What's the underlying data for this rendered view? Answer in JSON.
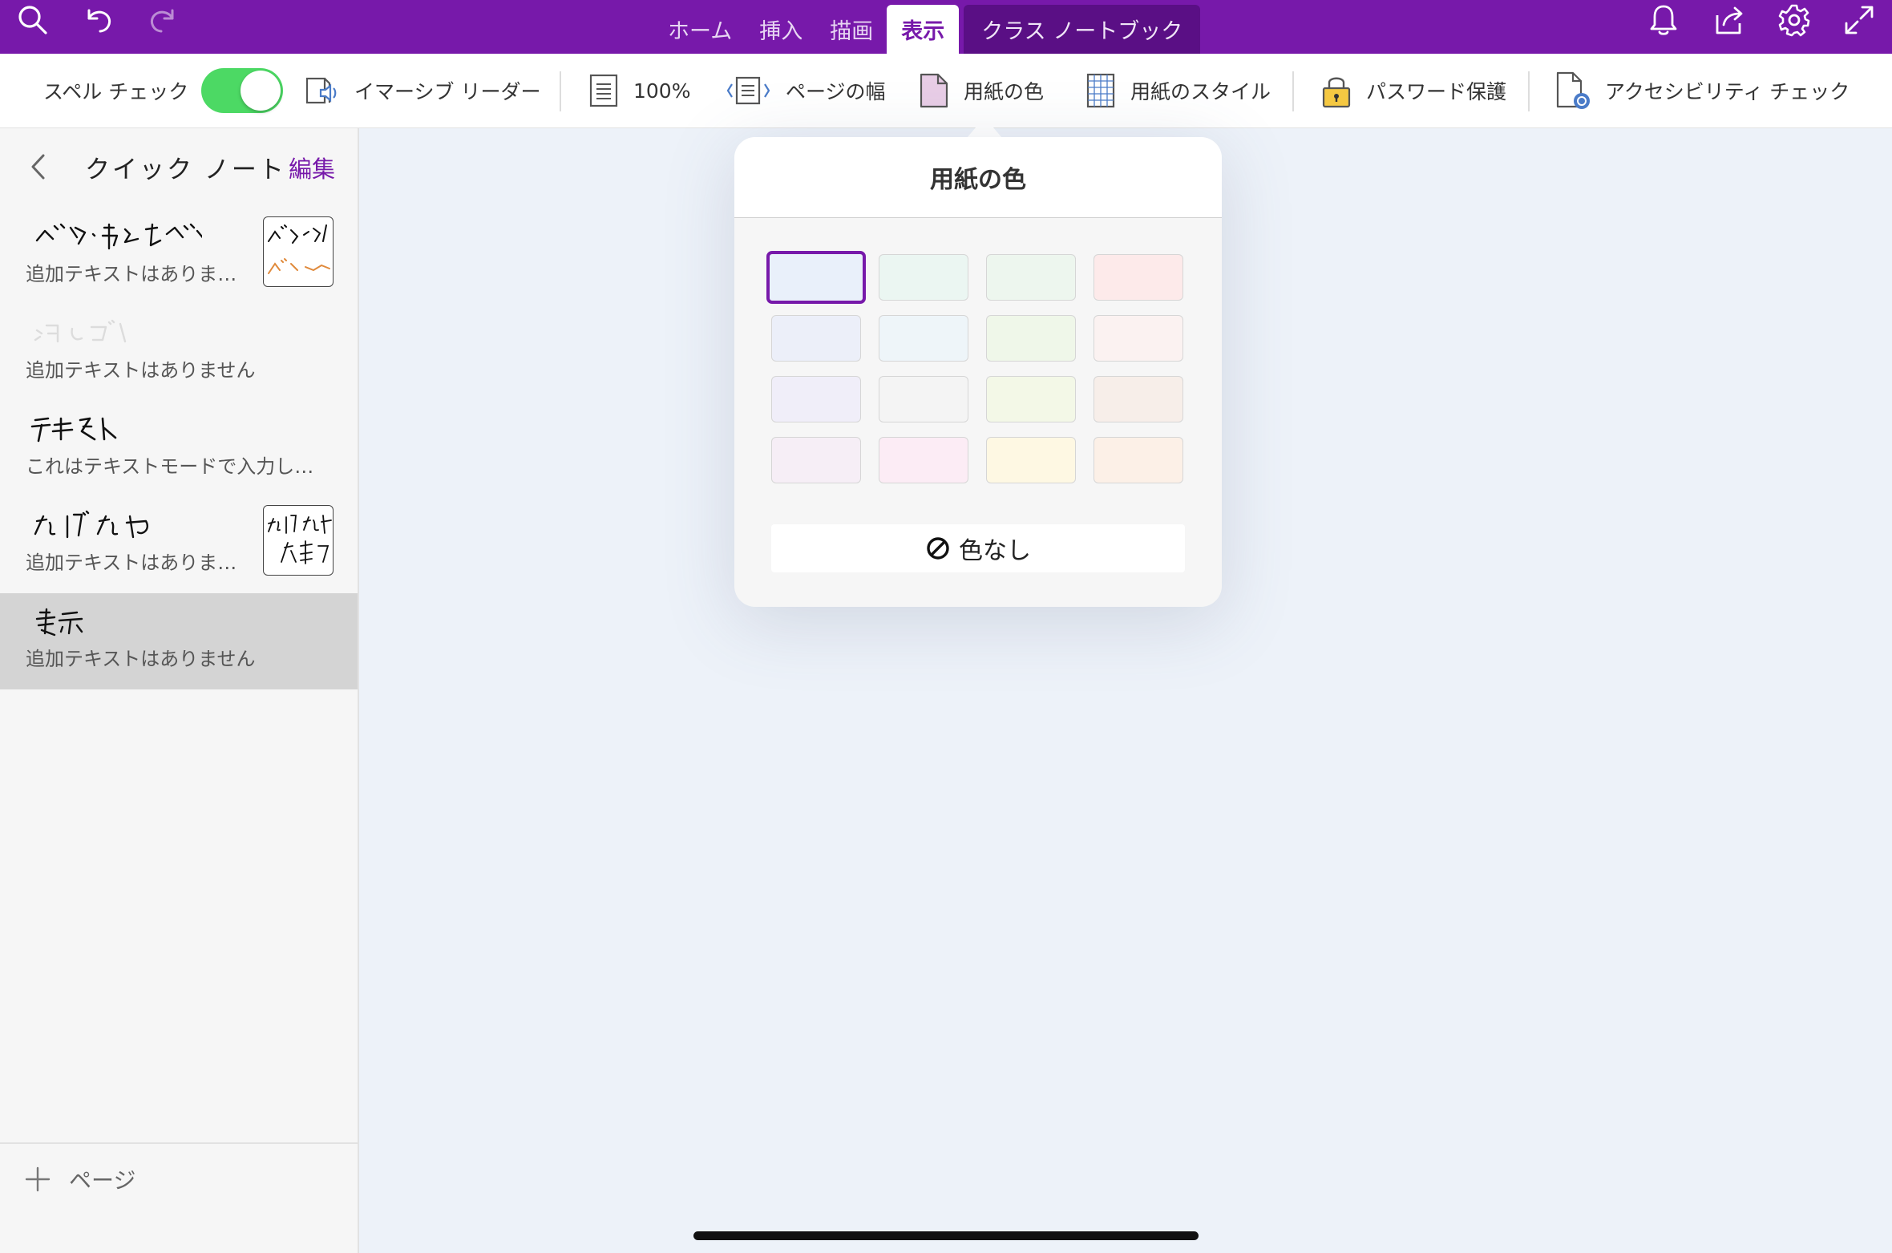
{
  "top_bar": {
    "tabs": [
      {
        "label": "ホーム"
      },
      {
        "label": "挿入"
      },
      {
        "label": "描画"
      },
      {
        "label": "表示"
      },
      {
        "label": "クラス ノートブック"
      }
    ],
    "active_tab": "表示",
    "accent_color": "#7719aa"
  },
  "ribbon": {
    "spell_check_label": "スペル チェック",
    "spell_check_on": true,
    "immersive_reader_label": "イマーシブ リーダー",
    "zoom_label": "100%",
    "page_width_label": "ページの幅",
    "paper_color_label": "用紙の色",
    "paper_style_label": "用紙のスタイル",
    "password_label": "パスワード保護",
    "accessibility_label": "アクセシビリティ チェック"
  },
  "sidebar": {
    "title": "クイック ノート",
    "edit_label": "編集",
    "pages": [
      {
        "title": "ペン・蛍光ペン",
        "subtitle": "追加テキストはありま…",
        "has_thumb": true
      },
      {
        "title": "消しゴム",
        "subtitle": "追加テキストはありません",
        "has_thumb": false
      },
      {
        "title": "テキスト",
        "subtitle": "これはテキストモードで入力し…",
        "has_thumb": false
      },
      {
        "title": "なげなわ",
        "subtitle": "追加テキストはありま…",
        "has_thumb": true
      },
      {
        "title": "表示",
        "subtitle": "追加テキストはありません",
        "has_thumb": false,
        "selected": true
      }
    ],
    "thumb_texts": [
      "ペン",
      "ペン",
      "なげなわ",
      "文章を"
    ],
    "add_page_label": "ページ"
  },
  "popover": {
    "title": "用紙の色",
    "swatches": [
      [
        "#e9f0fa",
        "#ebf6f2",
        "#edf6ee",
        "#fdeaea"
      ],
      [
        "#eceff9",
        "#eef5f9",
        "#eff7e9",
        "#fbf2f1"
      ],
      [
        "#f0eef9",
        "#f4f4f4",
        "#f3f8e7",
        "#f7eee9"
      ],
      [
        "#f6eef6",
        "#fcecf5",
        "#fef8e3",
        "#fcf0e7"
      ]
    ],
    "selected_swatch": "0-0",
    "no_color_label": "色なし"
  }
}
